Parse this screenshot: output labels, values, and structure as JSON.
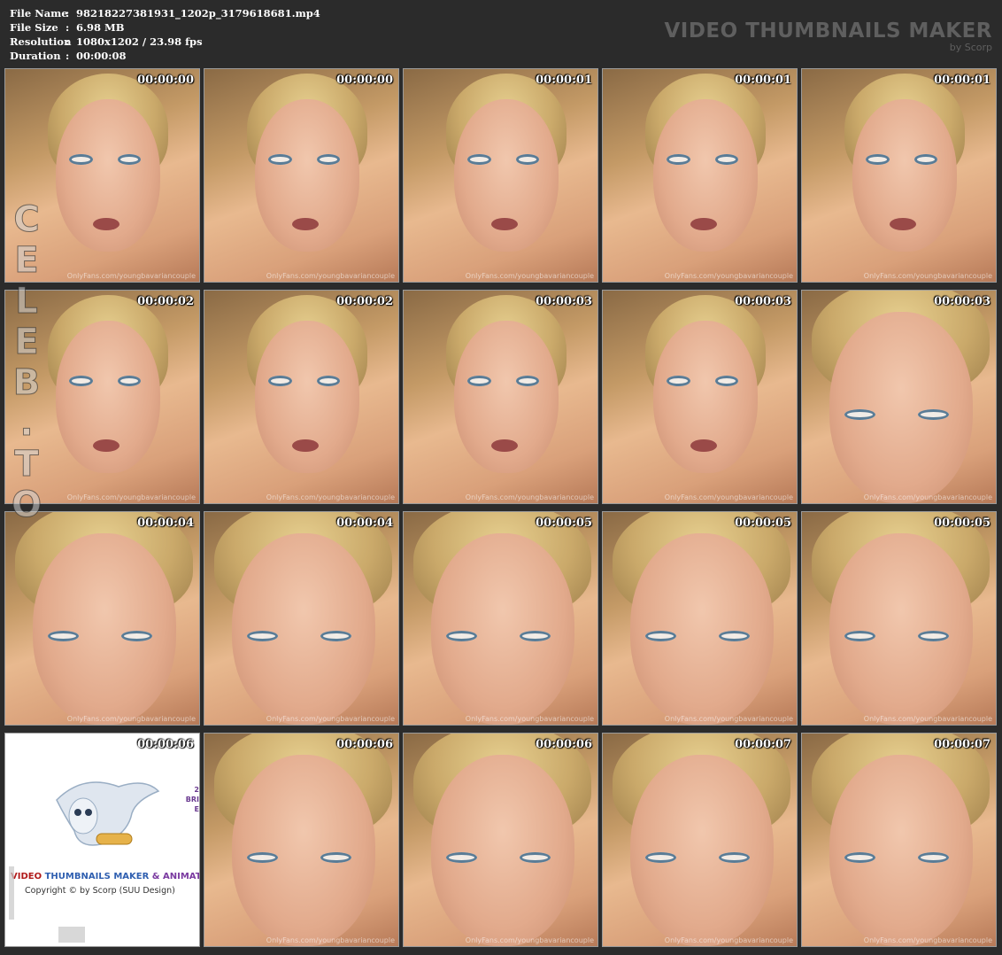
{
  "info": {
    "rows": [
      {
        "label": "File Name",
        "sep": ":",
        "value": "98218227381931_1202p_3179618681.mp4"
      },
      {
        "label": "File Size",
        "sep": ":",
        "value": "6.98 MB"
      },
      {
        "label": "Resolution",
        "sep": ":",
        "value": "1080x1202 / 23.98 fps"
      },
      {
        "label": "Duration",
        "sep": ":",
        "value": "00:00:08"
      }
    ]
  },
  "brand": {
    "title": "VIDEO THUMBNAILS MAKER",
    "subtitle": "by Scorp"
  },
  "side_watermark": [
    "C",
    "E",
    "L",
    "E",
    "B",
    ".",
    "T",
    "O"
  ],
  "thumb_watermark": "OnlyFans.com/youngbavariancouple",
  "thumbnails": [
    {
      "time": "00:00:00"
    },
    {
      "time": "00:00:00"
    },
    {
      "time": "00:00:01"
    },
    {
      "time": "00:00:01"
    },
    {
      "time": "00:00:01"
    },
    {
      "time": "00:00:02"
    },
    {
      "time": "00:00:02"
    },
    {
      "time": "00:00:03"
    },
    {
      "time": "00:00:03"
    },
    {
      "time": "00:00:03"
    },
    {
      "time": "00:00:04"
    },
    {
      "time": "00:00:04"
    },
    {
      "time": "00:00:05"
    },
    {
      "time": "00:00:05"
    },
    {
      "time": "00:00:05"
    },
    {
      "time": "00:00:06"
    },
    {
      "time": "00:00:06"
    },
    {
      "time": "00:00:06"
    },
    {
      "time": "00:00:07"
    },
    {
      "time": "00:00:07"
    }
  ],
  "promo": {
    "name_part1": "VIDEO ",
    "name_part2": "THUMBNAILS MAKER",
    "name_part3": " & ANIMATOR",
    "copyright": "Copyright © by Scorp (SUU Design)",
    "side_line1": "2",
    "side_line2": "BRI",
    "side_line3": "E"
  }
}
